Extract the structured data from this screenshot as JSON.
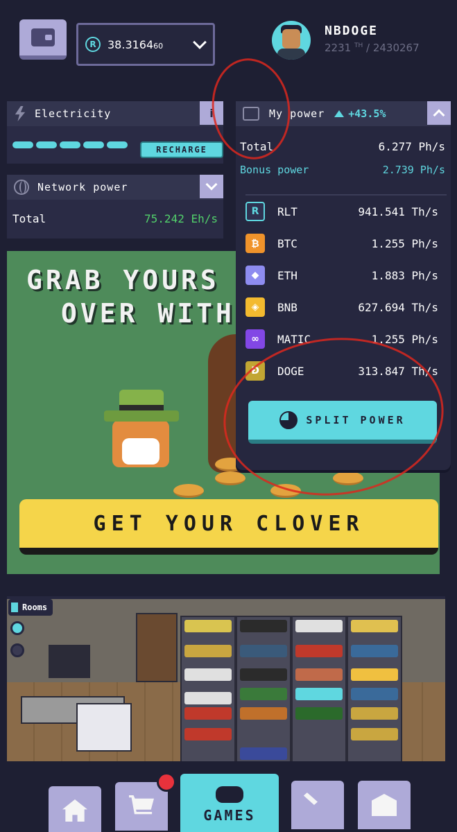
{
  "balance": {
    "amount": "38.3164",
    "small": "60"
  },
  "user": {
    "name": "NBDOGE",
    "rank": "2231",
    "rank_suffix": "TH",
    "rank_total": "/ 2430267"
  },
  "electricity": {
    "label": "Electricity",
    "info": "i",
    "recharge": "RECHARGE"
  },
  "network": {
    "label": "Network power",
    "total_label": "Total",
    "total_value": "75.242 Eh/s"
  },
  "mypower": {
    "label": "My power",
    "trend": "+43.5%",
    "total_label": "Total",
    "total_value": "6.277 Ph/s",
    "bonus_label": "Bonus power",
    "bonus_value": "2.739 Ph/s",
    "coins": [
      {
        "symbol": "RLT",
        "value": "941.541 Th/s",
        "glyph": "R",
        "color": "#2f3150"
      },
      {
        "symbol": "BTC",
        "value": "1.255 Ph/s",
        "glyph": "₿",
        "color": "#f0932b"
      },
      {
        "symbol": "ETH",
        "value": "1.883 Ph/s",
        "glyph": "◆",
        "color": "#8e8cf0"
      },
      {
        "symbol": "BNB",
        "value": "627.694 Th/s",
        "glyph": "◈",
        "color": "#f3ba2f"
      },
      {
        "symbol": "MATIC",
        "value": "1.255 Ph/s",
        "glyph": "∞",
        "color": "#8247e5"
      },
      {
        "symbol": "DOGE",
        "value": "313.847 Th/s",
        "glyph": "Ð",
        "color": "#c2a633"
      }
    ],
    "split_label": "SPLIT POWER"
  },
  "banner": {
    "line1": "GRAB YOURS",
    "line2": "OVER WITH",
    "cta": "GET YOUR CLOVER"
  },
  "rooms": {
    "label": "Rooms"
  },
  "nav": {
    "games": "GAMES"
  }
}
